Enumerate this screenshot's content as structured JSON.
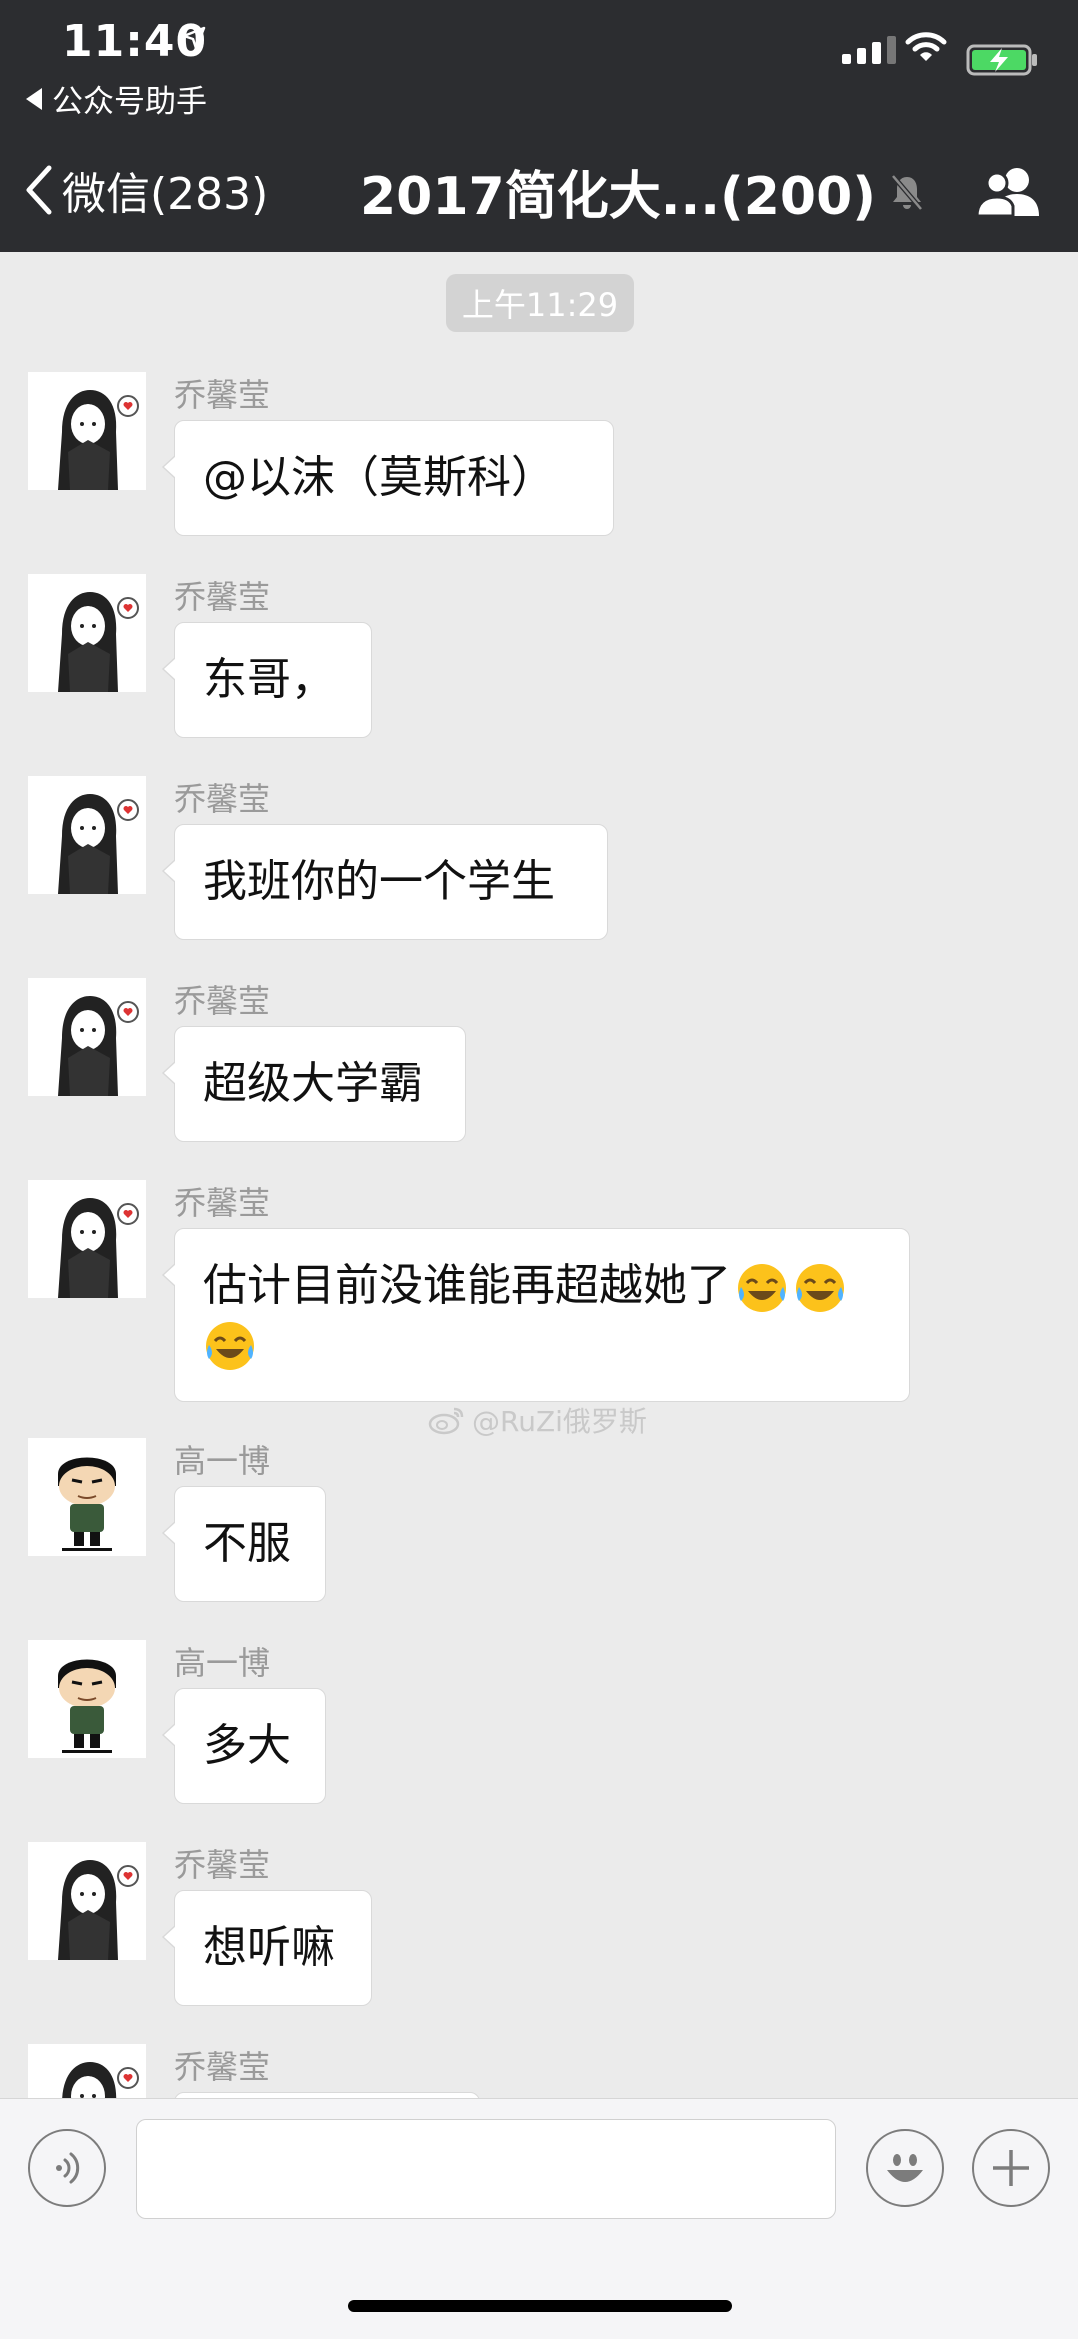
{
  "status_bar": {
    "time": "11:40",
    "back_app": "公众号助手"
  },
  "nav": {
    "back_label": "微信(283)",
    "title": "2017简化大...(200)"
  },
  "chat": {
    "time_badge": "上午11:29",
    "watermark": "@RuZi俄罗斯",
    "messages": [
      {
        "sender": "乔馨莹",
        "text": "@以沫（莫斯科）"
      },
      {
        "sender": "乔馨莹",
        "text": "东哥，"
      },
      {
        "sender": "乔馨莹",
        "text": "我班你的一个学生"
      },
      {
        "sender": "乔馨莹",
        "text": "超级大学霸"
      },
      {
        "sender": "乔馨莹",
        "text": "估计目前没谁能再超越她了"
      },
      {
        "sender": "高一博",
        "text": "不服"
      },
      {
        "sender": "高一博",
        "text": "多大"
      },
      {
        "sender": "乔馨莹",
        "text": "想听嘛"
      },
      {
        "sender": "乔馨莹",
        "text": ""
      }
    ]
  },
  "input": {
    "value": "",
    "placeholder": ""
  },
  "colors": {
    "header_bg": "#2c2d30",
    "chat_bg": "#ebebeb",
    "battery_green": "#4cd964"
  }
}
